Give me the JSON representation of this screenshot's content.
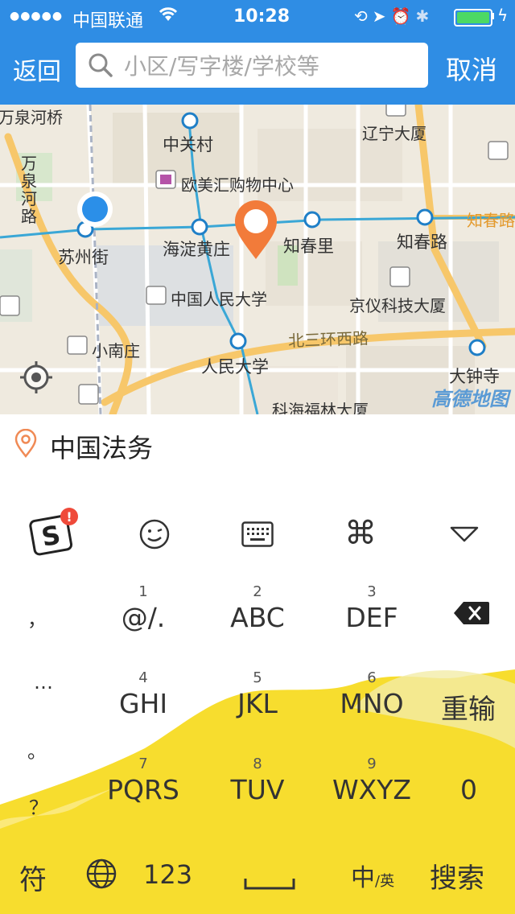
{
  "status_bar": {
    "signal_dots": "●●●●●",
    "carrier": "中国联通",
    "time": "10:28",
    "wifi_icon": "wifi-icon",
    "icons": [
      "lock-rotation-icon",
      "location-arrow-icon",
      "alarm-icon",
      "bluetooth-icon"
    ],
    "battery_color": "#4cd964"
  },
  "nav": {
    "back_label": "返回",
    "search_placeholder": "小区/写字楼/学校等",
    "search_value": "",
    "cancel_label": "取消",
    "bar_color": "#2f8de4"
  },
  "map": {
    "labels": [
      "万泉河桥",
      "中关村",
      "辽宁大厦",
      "欧美汇购物中心",
      "万泉河路",
      "苏州街",
      "海淀黄庄",
      "知春里",
      "知春路",
      "知春路",
      "中国人民大学",
      "京仪科技大厦",
      "小南庄",
      "北三环西路",
      "人民大学",
      "大钟寺",
      "科海福林大厦"
    ],
    "provider": "高德地图"
  },
  "selected_location": {
    "name": "中国法务"
  },
  "keyboard": {
    "toolbar": [
      "sogou-logo-icon",
      "emoji-icon",
      "keyboard-icon",
      "command-icon",
      "collapse-icon"
    ],
    "left_column": [
      "，",
      "…",
      "。",
      "？"
    ],
    "keys": [
      {
        "num": "1",
        "letters": "@/."
      },
      {
        "num": "2",
        "letters": "ABC"
      },
      {
        "num": "3",
        "letters": "DEF"
      },
      {
        "num": "4",
        "letters": "GHI"
      },
      {
        "num": "5",
        "letters": "JKL"
      },
      {
        "num": "6",
        "letters": "MNO"
      },
      {
        "num": "7",
        "letters": "PQRS"
      },
      {
        "num": "8",
        "letters": "TUV"
      },
      {
        "num": "9",
        "letters": "WXYZ"
      }
    ],
    "reenter_label": "重输",
    "zero_label": "0",
    "bottom": {
      "symbols_label": "符",
      "numbers_label": "123",
      "lang_main": "中",
      "lang_sub": "/英",
      "search_label": "搜索"
    },
    "accent_color": "#f7dd2e"
  }
}
